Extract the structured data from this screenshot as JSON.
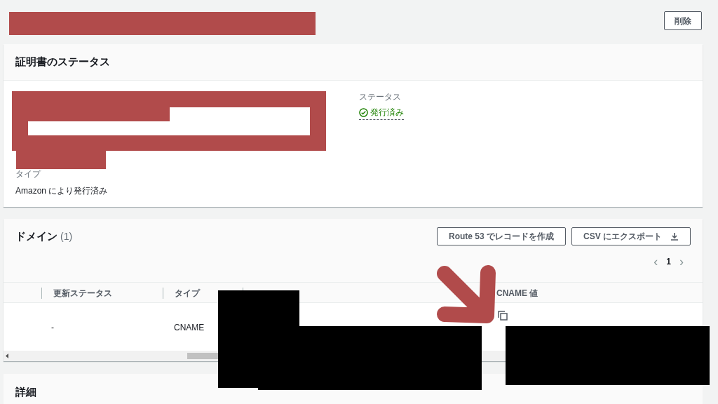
{
  "header": {
    "delete_button": "削除"
  },
  "certificate_status": {
    "title": "証明書のステータス",
    "type_label": "タイプ",
    "type_value": "Amazon により発行済み",
    "status_label": "ステータス",
    "status_value": "発行済み"
  },
  "domains": {
    "title": "ドメイン",
    "count": "(1)",
    "buttons": [
      {
        "label": "Route 53 でレコードを作成",
        "kind": "plain"
      },
      {
        "label": "CSV にエクスポート",
        "kind": "download"
      }
    ],
    "pagination": {
      "prev": "‹",
      "page": "1",
      "next": "›"
    },
    "columns": [
      "更新ステータス",
      "タイプ",
      "",
      "CNAME 値"
    ],
    "rows": [
      [
        "-",
        "CNAME",
        "",
        ""
      ]
    ]
  },
  "details": {
    "title": "詳細"
  }
}
